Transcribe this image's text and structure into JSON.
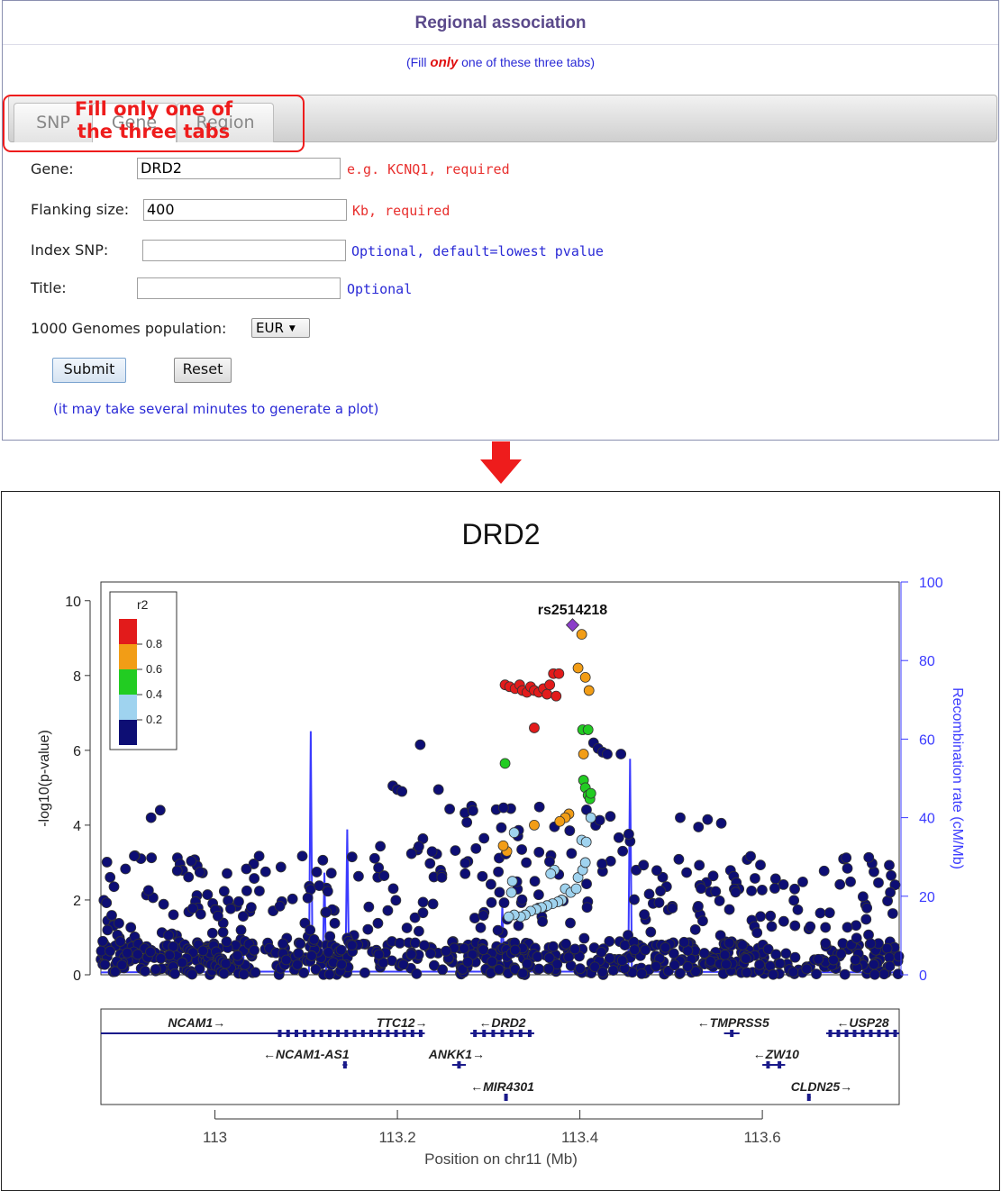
{
  "form": {
    "title": "Regional association",
    "note_prefix": "(Fill ",
    "note_em": "only",
    "note_suffix": " one of these three tabs)",
    "tabs": [
      "SNP",
      "Gene",
      "Region"
    ],
    "active_tab": "Gene",
    "annotation_line1": "Fill only one of",
    "annotation_line2": "the three tabs",
    "fields": {
      "gene_label": "Gene:",
      "gene_value": "DRD2",
      "gene_hint": "e.g. KCNQ1, required",
      "flank_label": "Flanking size:",
      "flank_value": "400",
      "flank_hint": "Kb, required",
      "index_label": "Index SNP:",
      "index_value": "",
      "index_hint": "Optional, default=lowest pvalue",
      "title_label": "Title:",
      "title_value": "",
      "title_hint": "Optional",
      "population_label": "1000 Genomes population:",
      "population_value": "EUR"
    },
    "submit_label": "Submit",
    "reset_label": "Reset",
    "footnote": "(it may take several minutes to generate a plot)"
  },
  "colors": {
    "panel_title": "#5b4a8b",
    "hint_red": "#e8302e",
    "hint_blue": "#2a2ad6",
    "annotation": "#ee1c1c",
    "arrow": "#ee1c1c",
    "ld_red": "#e21b1b",
    "ld_orange": "#f29d16",
    "ld_green": "#22cc22",
    "ld_lightblue": "#9fd3ef",
    "ld_navy": "#0d0e74",
    "index_purple": "#8b3ec9",
    "recomb": "#3b3bff"
  },
  "chart_data": {
    "type": "scatter",
    "title": "DRD2",
    "xlabel": "Position on chr11 (Mb)",
    "ylabel": "-log10(p-value)",
    "ylabel_right": "Recombination rate (cM/Mb)",
    "xlim": [
      112.875,
      113.75
    ],
    "ylim": [
      0,
      10.5
    ],
    "ylim_right": [
      0,
      100
    ],
    "x_ticks": [
      "113",
      "113.2",
      "113.4",
      "113.6"
    ],
    "y_ticks": [
      "0",
      "2",
      "4",
      "6",
      "8",
      "10"
    ],
    "y_ticks_right": [
      "0",
      "20",
      "40",
      "60",
      "80",
      "100"
    ],
    "legend": {
      "title": "r2",
      "entries": [
        "0.8",
        "0.6",
        "0.4",
        "0.2"
      ],
      "placement": "top-left"
    },
    "index_snp": {
      "name": "rs2514218",
      "x": 113.392,
      "y": 9.35
    },
    "ld_points": [
      {
        "ld": "red",
        "pts": [
          [
            113.318,
            7.75
          ],
          [
            113.323,
            7.7
          ],
          [
            113.329,
            7.65
          ],
          [
            113.334,
            7.75
          ],
          [
            113.337,
            7.6
          ],
          [
            113.342,
            7.55
          ],
          [
            113.346,
            7.7
          ],
          [
            113.35,
            7.6
          ],
          [
            113.355,
            7.55
          ],
          [
            113.36,
            7.65
          ],
          [
            113.364,
            7.5
          ],
          [
            113.367,
            7.75
          ],
          [
            113.371,
            8.05
          ],
          [
            113.374,
            7.45
          ],
          [
            113.377,
            8.05
          ],
          [
            113.35,
            6.6
          ]
        ]
      },
      {
        "ld": "orange",
        "pts": [
          [
            113.402,
            9.1
          ],
          [
            113.398,
            8.2
          ],
          [
            113.406,
            7.95
          ],
          [
            113.41,
            7.6
          ],
          [
            113.404,
            5.9
          ],
          [
            113.388,
            4.3
          ],
          [
            113.384,
            4.2
          ],
          [
            113.378,
            4.1
          ],
          [
            113.35,
            4.0
          ],
          [
            113.32,
            3.3
          ],
          [
            113.316,
            3.45
          ]
        ]
      },
      {
        "ld": "green",
        "pts": [
          [
            113.403,
            6.55
          ],
          [
            113.409,
            6.55
          ],
          [
            113.318,
            5.65
          ],
          [
            113.404,
            5.2
          ],
          [
            113.406,
            5.0
          ],
          [
            113.409,
            4.8
          ],
          [
            113.411,
            4.7
          ],
          [
            113.412,
            4.85
          ]
        ]
      },
      {
        "ld": "lightblue",
        "pts": [
          [
            113.412,
            4.2
          ],
          [
            113.402,
            3.6
          ],
          [
            113.407,
            3.55
          ],
          [
            113.328,
            3.8
          ],
          [
            113.372,
            2.8
          ],
          [
            113.368,
            2.7
          ],
          [
            113.326,
            2.5
          ],
          [
            113.325,
            2.2
          ],
          [
            113.384,
            2.3
          ],
          [
            113.39,
            2.2
          ],
          [
            113.38,
            2.0
          ],
          [
            113.376,
            1.95
          ],
          [
            113.37,
            1.9
          ],
          [
            113.364,
            1.85
          ],
          [
            113.358,
            1.8
          ],
          [
            113.352,
            1.75
          ],
          [
            113.346,
            1.7
          ],
          [
            113.34,
            1.6
          ],
          [
            113.335,
            1.55
          ],
          [
            113.328,
            1.6
          ],
          [
            113.322,
            1.55
          ],
          [
            113.396,
            2.3
          ],
          [
            113.398,
            2.6
          ],
          [
            113.403,
            2.8
          ],
          [
            113.406,
            3.0
          ]
        ]
      }
    ],
    "background_seed": 7,
    "recombination_peaks": [
      {
        "x": 113.03,
        "cm": 11
      },
      {
        "x": 113.105,
        "cm": 62
      },
      {
        "x": 113.12,
        "cm": 26
      },
      {
        "x": 113.145,
        "cm": 37
      },
      {
        "x": 113.315,
        "cm": 18
      },
      {
        "x": 113.455,
        "cm": 55
      }
    ],
    "genes": [
      {
        "name": "NCAM1→",
        "row": 1,
        "start": 112.875,
        "end": 113.185,
        "label_x": 112.98
      },
      {
        "name": "←NCAM1-AS1",
        "row": 2,
        "start": 113.14,
        "end": 113.145,
        "label_x": 113.1
      },
      {
        "name": "TTC12→",
        "row": 1,
        "start": 113.185,
        "end": 113.23,
        "label_x": 113.205
      },
      {
        "name": "ANKK1→",
        "row": 2,
        "start": 113.26,
        "end": 113.275,
        "label_x": 113.265
      },
      {
        "name": "←DRD2",
        "row": 1,
        "start": 113.28,
        "end": 113.35,
        "label_x": 113.315
      },
      {
        "name": "←MIR4301",
        "row": 3,
        "start": 113.318,
        "end": 113.32,
        "label_x": 113.315
      },
      {
        "name": "←TMPRSS5",
        "row": 1,
        "start": 113.558,
        "end": 113.575,
        "label_x": 113.568
      },
      {
        "name": "←ZW10",
        "row": 2,
        "start": 113.6,
        "end": 113.625,
        "label_x": 113.615
      },
      {
        "name": "CLDN25→",
        "row": 3,
        "start": 113.65,
        "end": 113.652,
        "label_x": 113.665
      },
      {
        "name": "←USP28",
        "row": 1,
        "start": 113.67,
        "end": 113.75,
        "label_x": 113.71
      }
    ]
  }
}
